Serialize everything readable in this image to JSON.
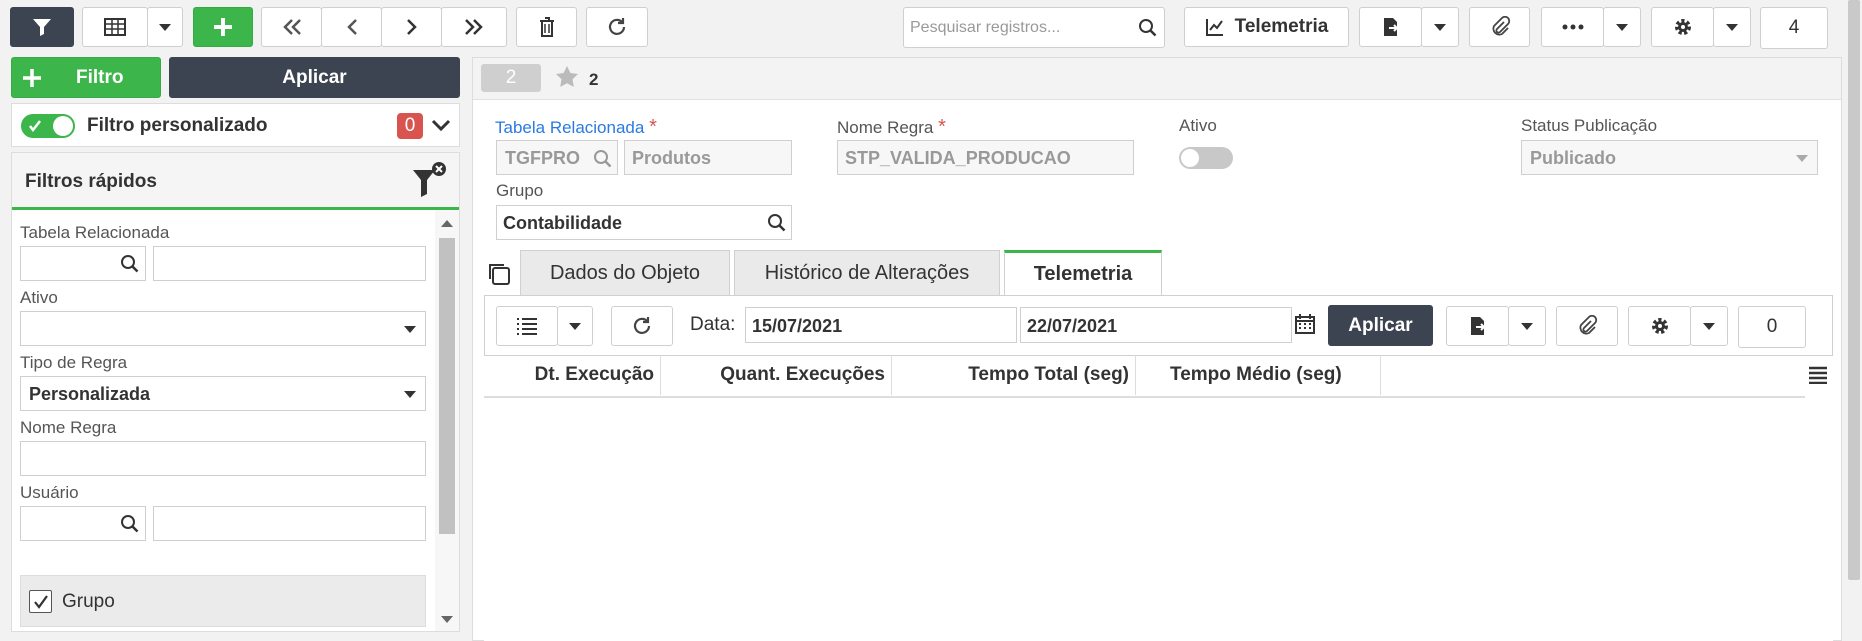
{
  "toolbar": {
    "search_placeholder": "Pesquisar registros...",
    "telemetria_label": "Telemetria",
    "counter": "4"
  },
  "left": {
    "add_filter_label": "Filtro",
    "apply_label": "Aplicar",
    "custom_filter_label": "Filtro personalizado",
    "custom_filter_count": "0",
    "quick_filters_title": "Filtros rápidos",
    "fields": {
      "tabela_label": "Tabela Relacionada",
      "ativo_label": "Ativo",
      "tipo_regra_label": "Tipo de Regra",
      "tipo_regra_value": "Personalizada",
      "nome_regra_label": "Nome Regra",
      "usuario_label": "Usuário",
      "grupo_label": "Grupo"
    }
  },
  "record": {
    "index": "2",
    "favorites": "2",
    "tabela_label": "Tabela Relacionada",
    "tabela_code": "TGFPRO",
    "tabela_desc": "Produtos",
    "nome_regra_label": "Nome Regra",
    "nome_regra_value": "STP_VALIDA_PRODUCAO",
    "ativo_label": "Ativo",
    "status_label": "Status Publicação",
    "status_value": "Publicado",
    "grupo_label": "Grupo",
    "grupo_value": "Contabilidade",
    "required_mark": "*"
  },
  "tabs": [
    {
      "label": "Dados do Objeto"
    },
    {
      "label": "Histórico de Alterações"
    },
    {
      "label": "Telemetria"
    }
  ],
  "telemetry": {
    "date_label": "Data:",
    "date_from": "15/07/2021",
    "date_to": "22/07/2021",
    "apply_label": "Aplicar",
    "counter": "0",
    "columns": [
      "Dt. Execução",
      "Quant. Execuções",
      "Tempo Total (seg)",
      "Tempo Médio (seg)"
    ]
  },
  "colors": {
    "accent_green": "#3cb64a",
    "dark": "#3d4451",
    "required": "#d9534f",
    "link_blue": "#2a7ae2"
  }
}
